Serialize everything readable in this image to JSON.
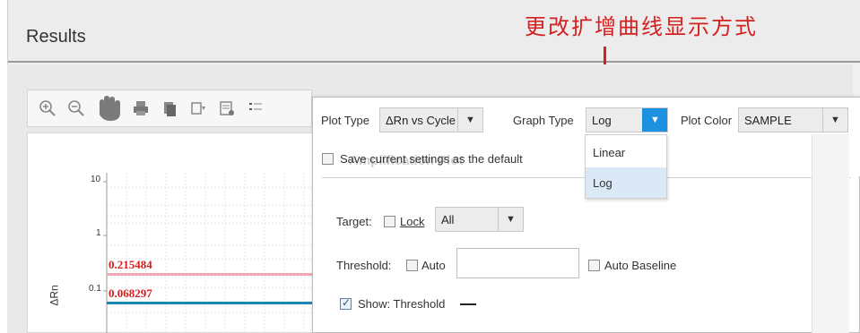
{
  "header": {
    "title": "Results"
  },
  "annotation": {
    "text": "更改扩增曲线显示方式",
    "color": "#d62020"
  },
  "toolbar": {
    "buttons": [
      "zoom-in-icon",
      "zoom-out-icon",
      "pan-hand-icon",
      "print-icon",
      "copy-icon",
      "export-icon",
      "properties-icon",
      "legend-icon"
    ]
  },
  "plot": {
    "y_axis_label": "ΔRn",
    "y_ticks": [
      "10",
      "1",
      "0.1"
    ],
    "threshold_values": [
      "0.215484",
      "0.068297"
    ],
    "threshold_colors": [
      "#f3a7b5",
      "#1a87b5"
    ]
  },
  "controls": {
    "plot_type_label": "Plot Type",
    "plot_type_value": "ΔRn vs Cycle",
    "graph_type_label": "Graph Type",
    "graph_type_value": "Log",
    "plot_color_label": "Plot Color",
    "plot_color_value": "SAMPLE",
    "save_default_label": "Save current settings as the default",
    "ghost_title": "Amplification Plot",
    "graph_type_options": [
      "Linear",
      "Log"
    ],
    "target_label": "Target:",
    "lock_label": "Lock",
    "target_value": "All",
    "threshold_label": "Threshold:",
    "threshold_auto_label": "Auto",
    "auto_baseline_label": "Auto Baseline",
    "show_threshold_label": "Show: Threshold"
  }
}
